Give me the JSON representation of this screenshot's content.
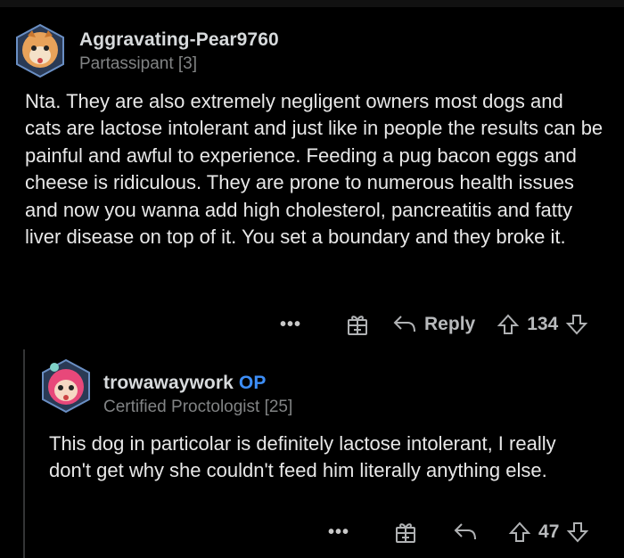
{
  "comment": {
    "username": "Aggravating-Pear9760",
    "flair": "Partassipant [3]",
    "body": "Nta. They are also extremely negligent owners most dogs and cats are lactose intolerant and just like in people the results can be painful and awful to experience. Feeding a pug bacon eggs and cheese is ridiculous. They are prone to numerous health issues and now you wanna add high cholesterol, pancreatitis and fatty liver disease on top of it. You set a boundary and they broke it.",
    "actions": {
      "more": "•••",
      "reply": "Reply",
      "votes": "134"
    }
  },
  "reply": {
    "username": "trowawaywork",
    "op_label": "OP",
    "flair": "Certified Proctologist [25]",
    "body": "This dog in particolar is definitely lactose intolerant, I really don't get why she couldn't feed him literally anything else.",
    "actions": {
      "more": "•••",
      "votes": "47"
    }
  },
  "colors": {
    "background": "#000000",
    "text": "#e8e8e8",
    "muted": "#818384",
    "op": "#3d8ef7"
  }
}
